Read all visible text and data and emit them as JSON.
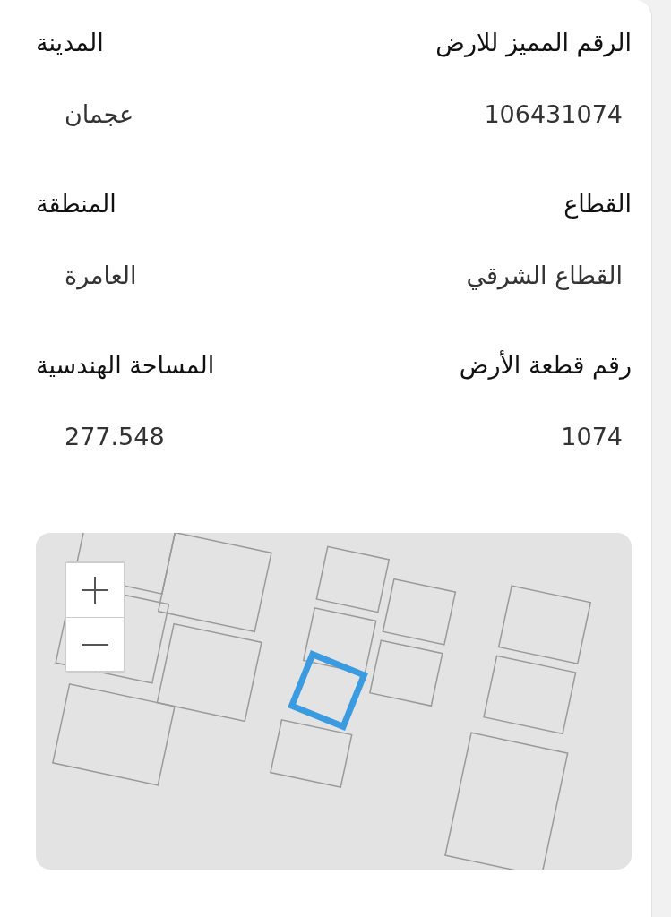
{
  "fields": [
    {
      "label": "الرقم المميز للارض",
      "value": "106431074"
    },
    {
      "label": "المدينة",
      "value": "عجمان"
    },
    {
      "label": "القطاع",
      "value": "القطاع الشرقي"
    },
    {
      "label": "المنطقة",
      "value": "العامرة"
    },
    {
      "label": "رقم قطعة الأرض",
      "value": "1074"
    },
    {
      "label": "المساحة الهندسية",
      "value": "277.548"
    }
  ]
}
